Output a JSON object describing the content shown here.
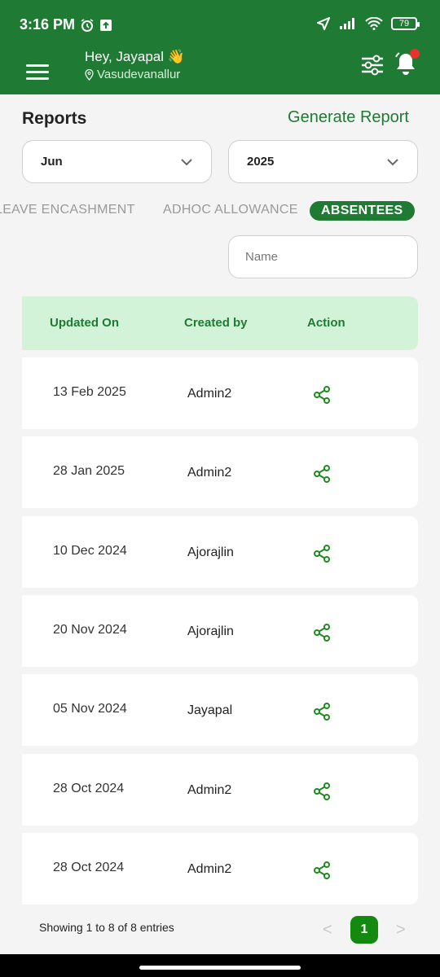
{
  "status": {
    "time": "3:16 PM",
    "battery": "79"
  },
  "header": {
    "greeting": "Hey, Jayapal 👋",
    "location": "Vasudevanallur"
  },
  "page": {
    "title": "Reports",
    "generate_label": "Generate Report"
  },
  "filters": {
    "month": "Jun",
    "year": "2025"
  },
  "tabs": [
    {
      "label": "LEAVE ENCASHMENT"
    },
    {
      "label": "ADHOC ALLOWANCE"
    },
    {
      "label": "ABSENTEES"
    }
  ],
  "search": {
    "placeholder": "Name"
  },
  "table": {
    "headers": [
      "Updated On",
      "Created by",
      "Action"
    ],
    "rows": [
      {
        "date": "13 Feb 2025",
        "by": "Admin2"
      },
      {
        "date": "28 Jan 2025",
        "by": "Admin2"
      },
      {
        "date": "10 Dec 2024",
        "by": "Ajorajlin"
      },
      {
        "date": "20 Nov 2024",
        "by": "Ajorajlin"
      },
      {
        "date": "05 Nov 2024",
        "by": "Jayapal"
      },
      {
        "date": "28 Oct 2024",
        "by": "Admin2"
      },
      {
        "date": "28 Oct 2024",
        "by": "Admin2"
      }
    ]
  },
  "pagination": {
    "summary": "Showing 1 to 8 of 8 entries",
    "prev": "<",
    "page": "1",
    "next": ">"
  },
  "colors": {
    "primary": "#1f7a33",
    "header_row": "#d3f3d8",
    "active_page": "#14890f",
    "notification": "#e8322c"
  },
  "icons": [
    "alarm-icon",
    "upload-icon",
    "location-arrow-icon",
    "signal-icon",
    "wifi-icon",
    "battery-icon",
    "menu-icon",
    "pin-icon",
    "filter-icon",
    "bell-icon",
    "chevron-down-icon",
    "share-icon"
  ]
}
